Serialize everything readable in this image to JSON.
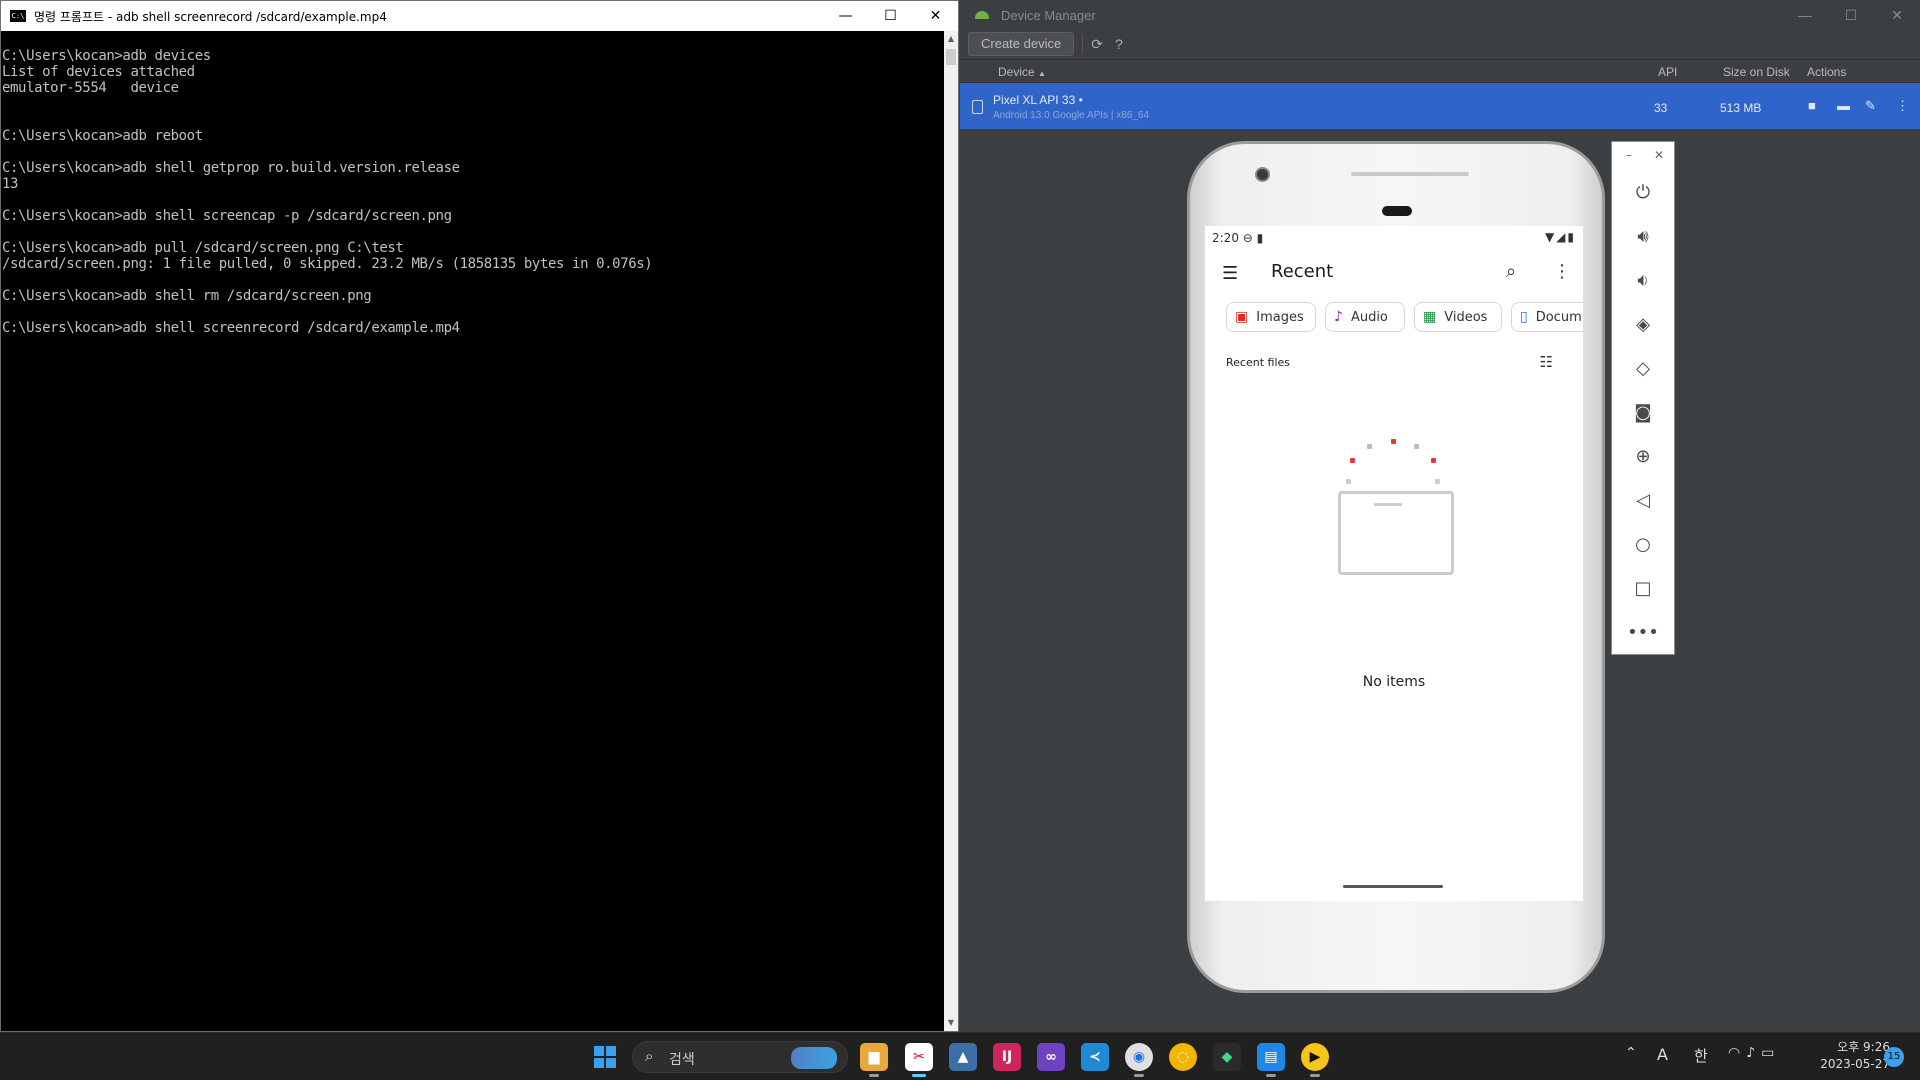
{
  "cmd": {
    "title": "명령 프롬프트 - adb  shell screenrecord /sdcard/example.mp4",
    "icon": "cmd-icon",
    "lines": [
      "C:\\Users\\kocan>adb devices",
      "List of devices attached",
      "emulator-5554   device",
      "",
      "",
      "C:\\Users\\kocan>adb reboot",
      "",
      "C:\\Users\\kocan>adb shell getprop ro.build.version.release",
      "13",
      "",
      "C:\\Users\\kocan>adb shell screencap -p /sdcard/screen.png",
      "",
      "C:\\Users\\kocan>adb pull /sdcard/screen.png C:\\test",
      "/sdcard/screen.png: 1 file pulled, 0 skipped. 23.2 MB/s (1858135 bytes in 0.076s)",
      "",
      "C:\\Users\\kocan>adb shell rm /sdcard/screen.png",
      "",
      "C:\\Users\\kocan>adb shell screenrecord /sdcard/example.mp4"
    ]
  },
  "device_manager": {
    "title": "Device Manager",
    "create_label": "Create device",
    "columns": {
      "device": "Device",
      "api": "API",
      "size": "Size on Disk",
      "actions": "Actions"
    },
    "device": {
      "name": "Pixel XL API 33",
      "subtitle": "Android 13.0 Google APIs | x86_64",
      "api": "33",
      "size": "513 MB"
    },
    "accent": "#2f65ca"
  },
  "emulator": {
    "status_time": "2:20",
    "app_title": "Recent",
    "chips": [
      "Images",
      "Audio",
      "Videos",
      "Docum"
    ],
    "recent_label": "Recent files",
    "empty_label": "No items"
  },
  "taskbar": {
    "search_label": "검색",
    "ime_a": "A",
    "ime_han": "한",
    "clock_time": "오후 9:26",
    "clock_date": "2023-05-27",
    "notification_count": "15"
  }
}
